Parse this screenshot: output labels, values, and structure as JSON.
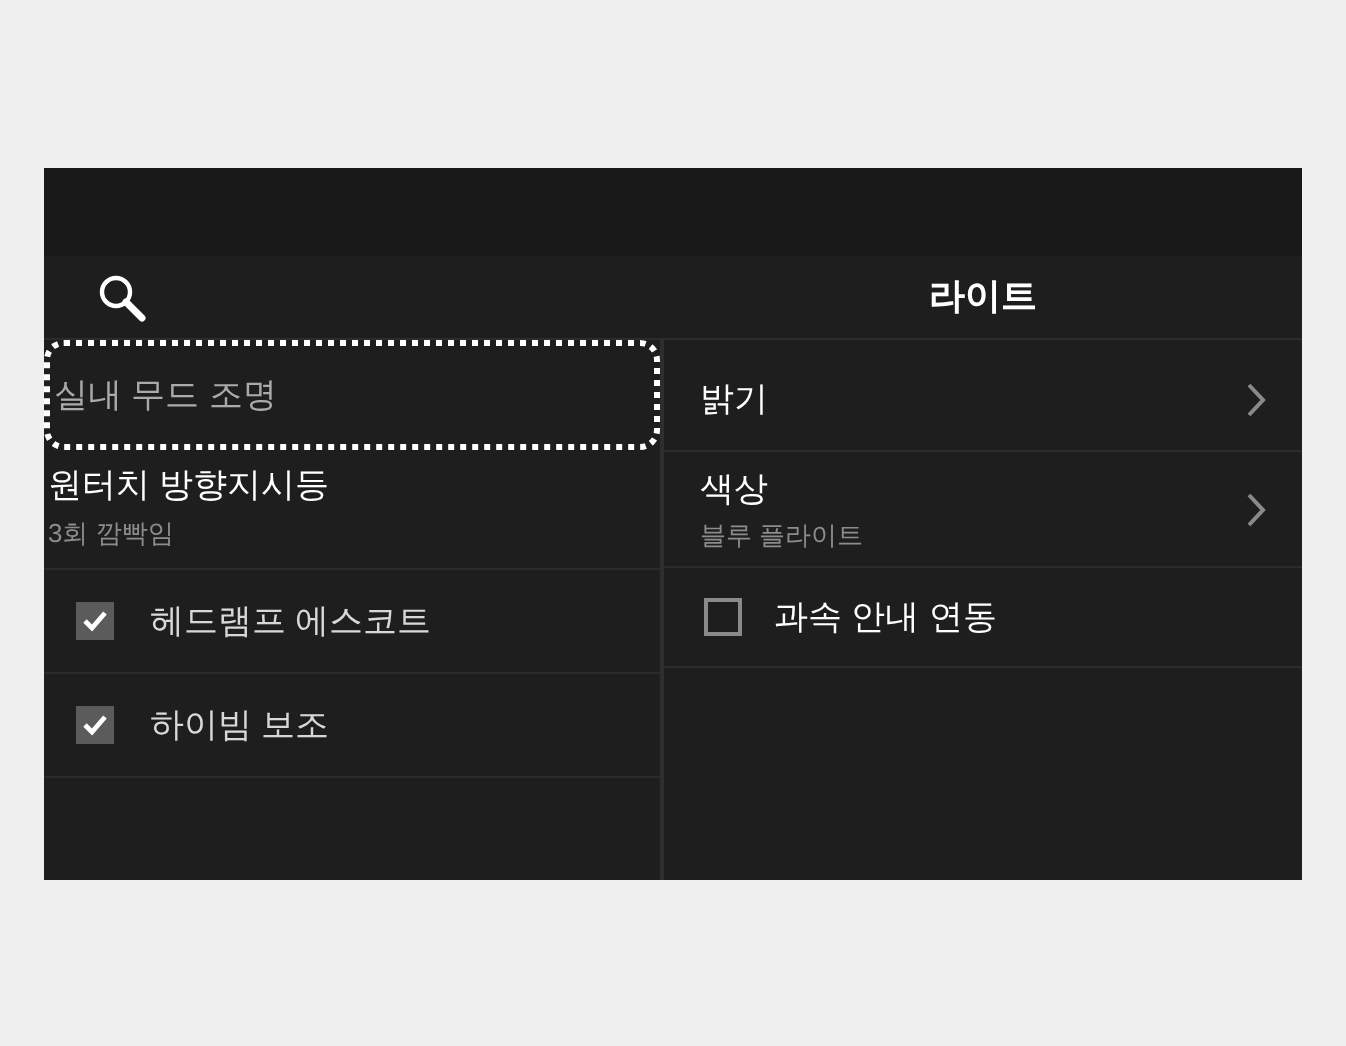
{
  "header": {
    "title": "라이트"
  },
  "left_items": [
    {
      "kind": "item",
      "label": "실내 무드 조명",
      "selected": true
    },
    {
      "kind": "item",
      "label": "원터치 방향지시등",
      "sublabel": "3회 깜빡임",
      "selected": false
    },
    {
      "kind": "checkbox",
      "label": "헤드램프 에스코트",
      "checked": true
    },
    {
      "kind": "checkbox",
      "label": "하이빔 보조",
      "checked": true
    }
  ],
  "right_items": [
    {
      "kind": "link",
      "label": "밝기"
    },
    {
      "kind": "link",
      "label": "색상",
      "sublabel": "블루 플라이트"
    },
    {
      "kind": "checkbox",
      "label": "과속 안내 연동",
      "checked": false
    }
  ]
}
